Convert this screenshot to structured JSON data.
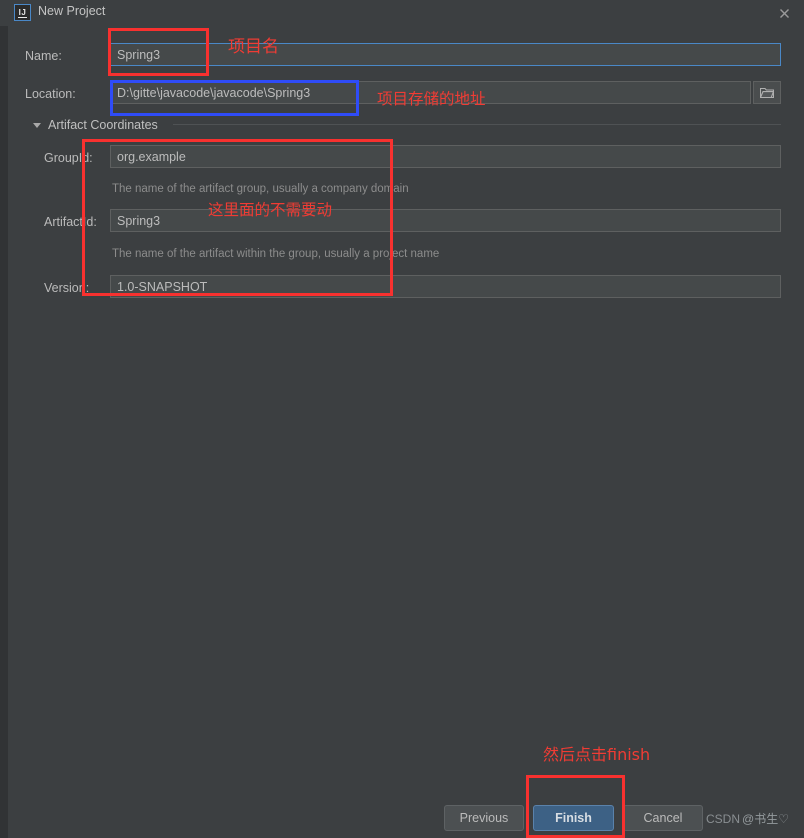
{
  "window": {
    "title": "New Project",
    "logo_text": "IJ",
    "close_icon": "close-icon"
  },
  "form": {
    "name": {
      "label": "Name:",
      "value": "Spring3"
    },
    "location": {
      "label": "Location:",
      "value": "D:\\gitte\\javacode\\javacode\\Spring3",
      "browse_icon": "folder-icon"
    },
    "section": {
      "title": "Artifact Coordinates",
      "expanded": true,
      "toggle_icon": "chevron-down-icon"
    },
    "group_id": {
      "label": "GroupId:",
      "value": "org.example",
      "hint": "The name of the artifact group, usually a company domain"
    },
    "artifact_id": {
      "label": "ArtifactId:",
      "value": "Spring3",
      "hint": "The name of the artifact within the group, usually a project name"
    },
    "version": {
      "label": "Version:",
      "value": "1.0-SNAPSHOT"
    }
  },
  "footer": {
    "previous_label": "Previous",
    "finish_label": "Finish",
    "cancel_label": "Cancel"
  },
  "annotations": [
    {
      "id": "name-note",
      "text": "项目名"
    },
    {
      "id": "location-note",
      "text": "项目存储的地址"
    },
    {
      "id": "coords-note",
      "text": "这里面的不需要动"
    },
    {
      "id": "finish-note",
      "text": "然后点击finish"
    }
  ],
  "watermark": {
    "prefix": "CSDN",
    "handle": "@书生♡"
  },
  "colors": {
    "background": "#3c3f41",
    "field_bg": "#45494a",
    "accent_blue": "#4a88c7",
    "primary_button": "#3d6185",
    "annotation_red": "#f8312f",
    "annotation_blue": "#2f4cf8"
  }
}
